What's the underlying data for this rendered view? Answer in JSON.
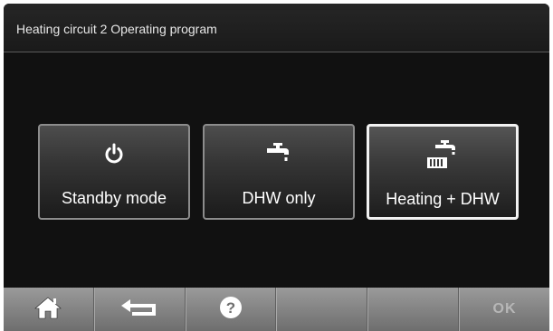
{
  "header": {
    "title": "Heating circuit 2 Operating program"
  },
  "programs": [
    {
      "label": "Standby mode",
      "icon": "power-icon",
      "selected": false
    },
    {
      "label": "DHW only",
      "icon": "tap-icon",
      "selected": false
    },
    {
      "label": "Heating + DHW",
      "icon": "radiator-tap-icon",
      "selected": true
    }
  ],
  "footer": {
    "ok_label": "OK",
    "icons": [
      "home-icon",
      "back-icon",
      "help-icon"
    ]
  },
  "colors": {
    "background": "#111111",
    "footer": "#8a8a8a",
    "selected_border": "#f2f2f2"
  }
}
